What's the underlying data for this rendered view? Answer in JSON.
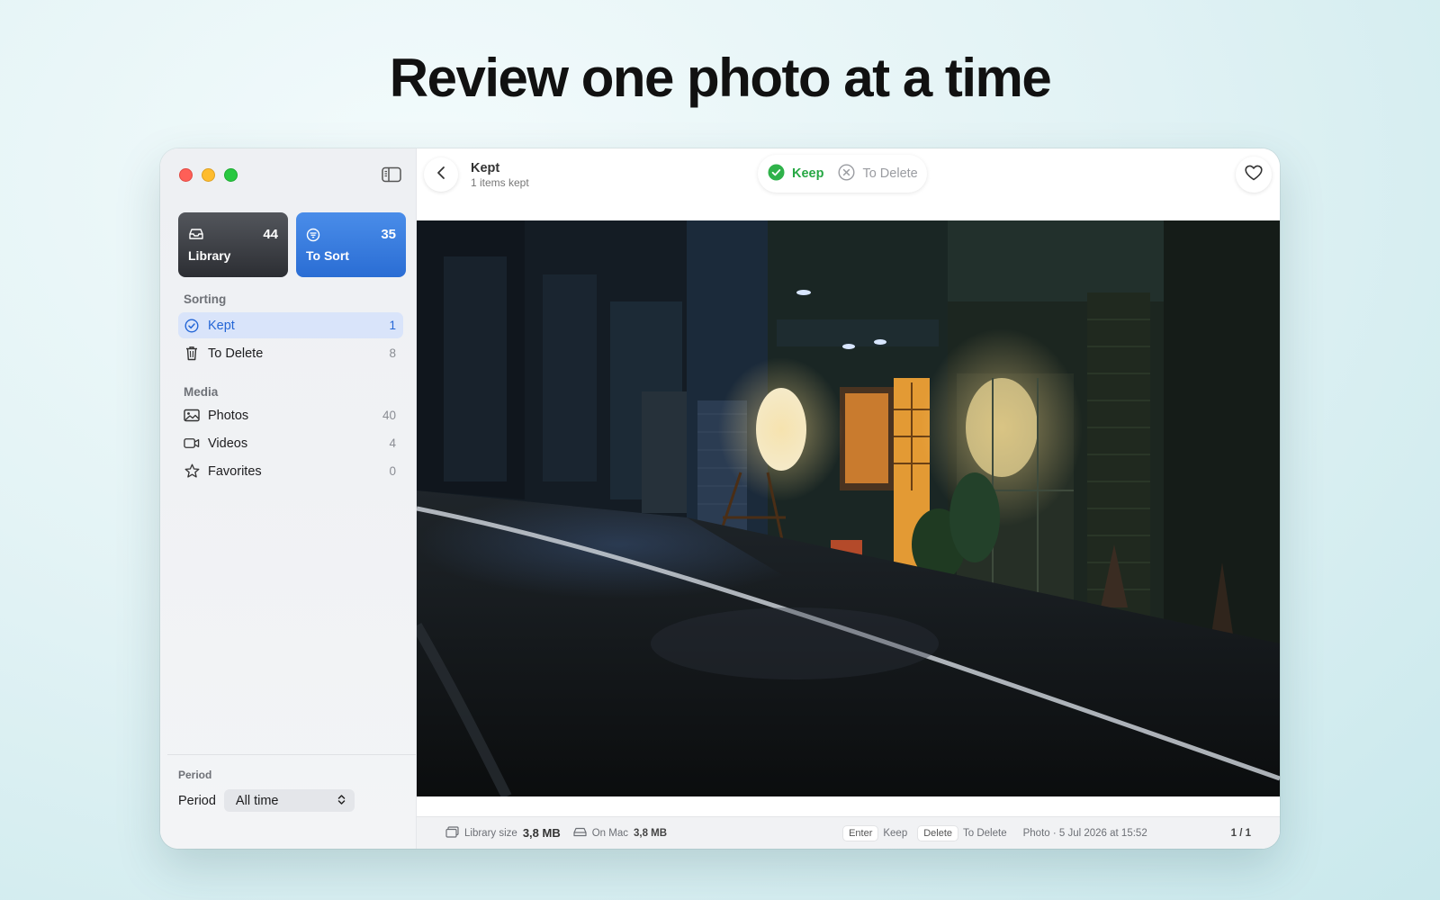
{
  "headline": "Review one photo at a time",
  "window": {
    "cards": [
      {
        "label": "Library",
        "count": "44",
        "icon": "tray-icon"
      },
      {
        "label": "To Sort",
        "count": "35",
        "icon": "filter-circle-icon"
      }
    ],
    "sorting_title": "Sorting",
    "sorting_items": [
      {
        "label": "Kept",
        "count": "1",
        "icon": "checkmark-circle-icon",
        "active": true
      },
      {
        "label": "To Delete",
        "count": "8",
        "icon": "trash-icon"
      }
    ],
    "media_title": "Media",
    "media_items": [
      {
        "label": "Photos",
        "count": "40",
        "icon": "photo-icon"
      },
      {
        "label": "Videos",
        "count": "4",
        "icon": "video-icon"
      },
      {
        "label": "Favorites",
        "count": "0",
        "icon": "star-icon"
      }
    ],
    "period": {
      "section_title": "Period",
      "label": "Period",
      "selected": "All time"
    }
  },
  "main": {
    "title": "Kept",
    "subtitle": "1 items kept",
    "segmented": {
      "keep_label": "Keep",
      "delete_label": "To Delete"
    },
    "footer": {
      "library_size_label": "Library size",
      "library_size_value": "3,8 MB",
      "on_mac_label": "On Mac",
      "on_mac_value": "3,8 MB",
      "shortcuts": [
        {
          "key": "Enter",
          "action": "Keep"
        },
        {
          "key": "Delete",
          "action": "To Delete"
        }
      ],
      "photo_info": "Photo · 5 Jul 2026 at 15:52",
      "pager": "1 / 1"
    }
  },
  "colors": {
    "accent_blue": "#2a6dd4",
    "keep_green": "#27a844",
    "active_row": "#d9e4fa"
  }
}
